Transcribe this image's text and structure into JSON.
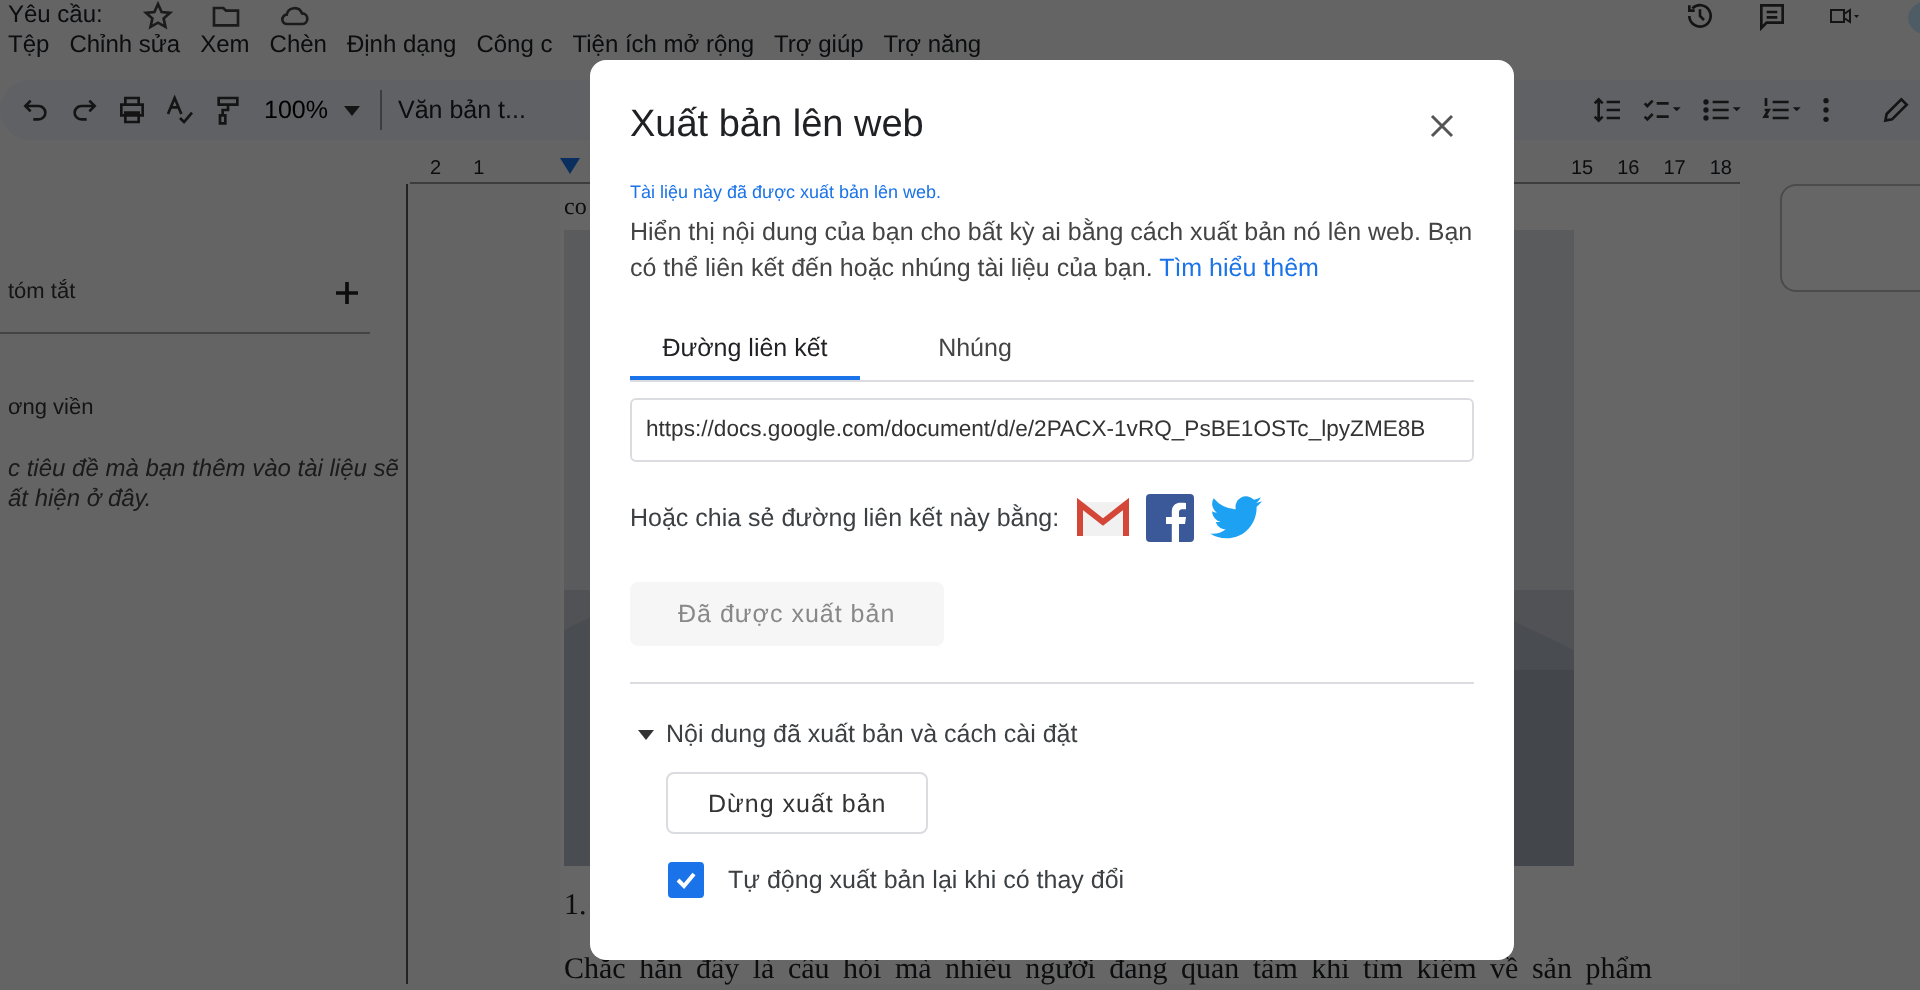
{
  "document": {
    "title": "Yêu cầu:"
  },
  "menu": [
    "Tệp",
    "Chỉnh sửa",
    "Xem",
    "Chèn",
    "Định dạng",
    "Công c",
    "Tiện ích mở rộng",
    "Trợ giúp",
    "Trợ năng"
  ],
  "toolbar": {
    "zoom": "100%",
    "style": "Văn bản t..."
  },
  "ruler": {
    "left_numbers": [
      "2",
      "1"
    ],
    "right_numbers": [
      "15",
      "16",
      "17",
      "18"
    ]
  },
  "sidebar": {
    "summary_label": "tóm tắt",
    "outline_label": "ơng viền",
    "outline_hint": [
      "c tiêu đề mà bạn thêm vào tài liệu sẽ",
      "ất hiện ở đây."
    ]
  },
  "doc_body": {
    "fragment": "co",
    "list_number": "1.",
    "paragraph": "Chắc hẳn đây là câu hỏi mà nhiều người đang quan tâm khi tìm kiếm về sản phẩm"
  },
  "dialog": {
    "title": "Xuất bản lên web",
    "status": "Tài liệu này đã được xuất bản lên web.",
    "description": "Hiển thị nội dung của bạn cho bất kỳ ai bằng cách xuất bản nó lên web. Bạn có thể liên kết đến hoặc nhúng tài liệu của bạn.",
    "link": "Tìm hiểu thêm",
    "tabs": [
      {
        "label": "Đường liên kết",
        "selected": true
      },
      {
        "label": "Nhúng",
        "selected": false
      }
    ],
    "url": "https://docs.google.com/document/d/e/2PACX-1vRQ_PsBE1OSTc_lpyZME8B",
    "share_label": "Hoặc chia sẻ đường liên kết này bằng:",
    "published_button": {
      "label": "Đã được xuất bản",
      "disabled": true
    },
    "section": {
      "label": "Nội dung đã xuất bản và cách cài đặt",
      "expanded": true
    },
    "stop_button": "Dừng xuất bản",
    "auto_republish": {
      "label": "Tự động xuất bản lại khi có thay đổi",
      "checked": true
    }
  }
}
